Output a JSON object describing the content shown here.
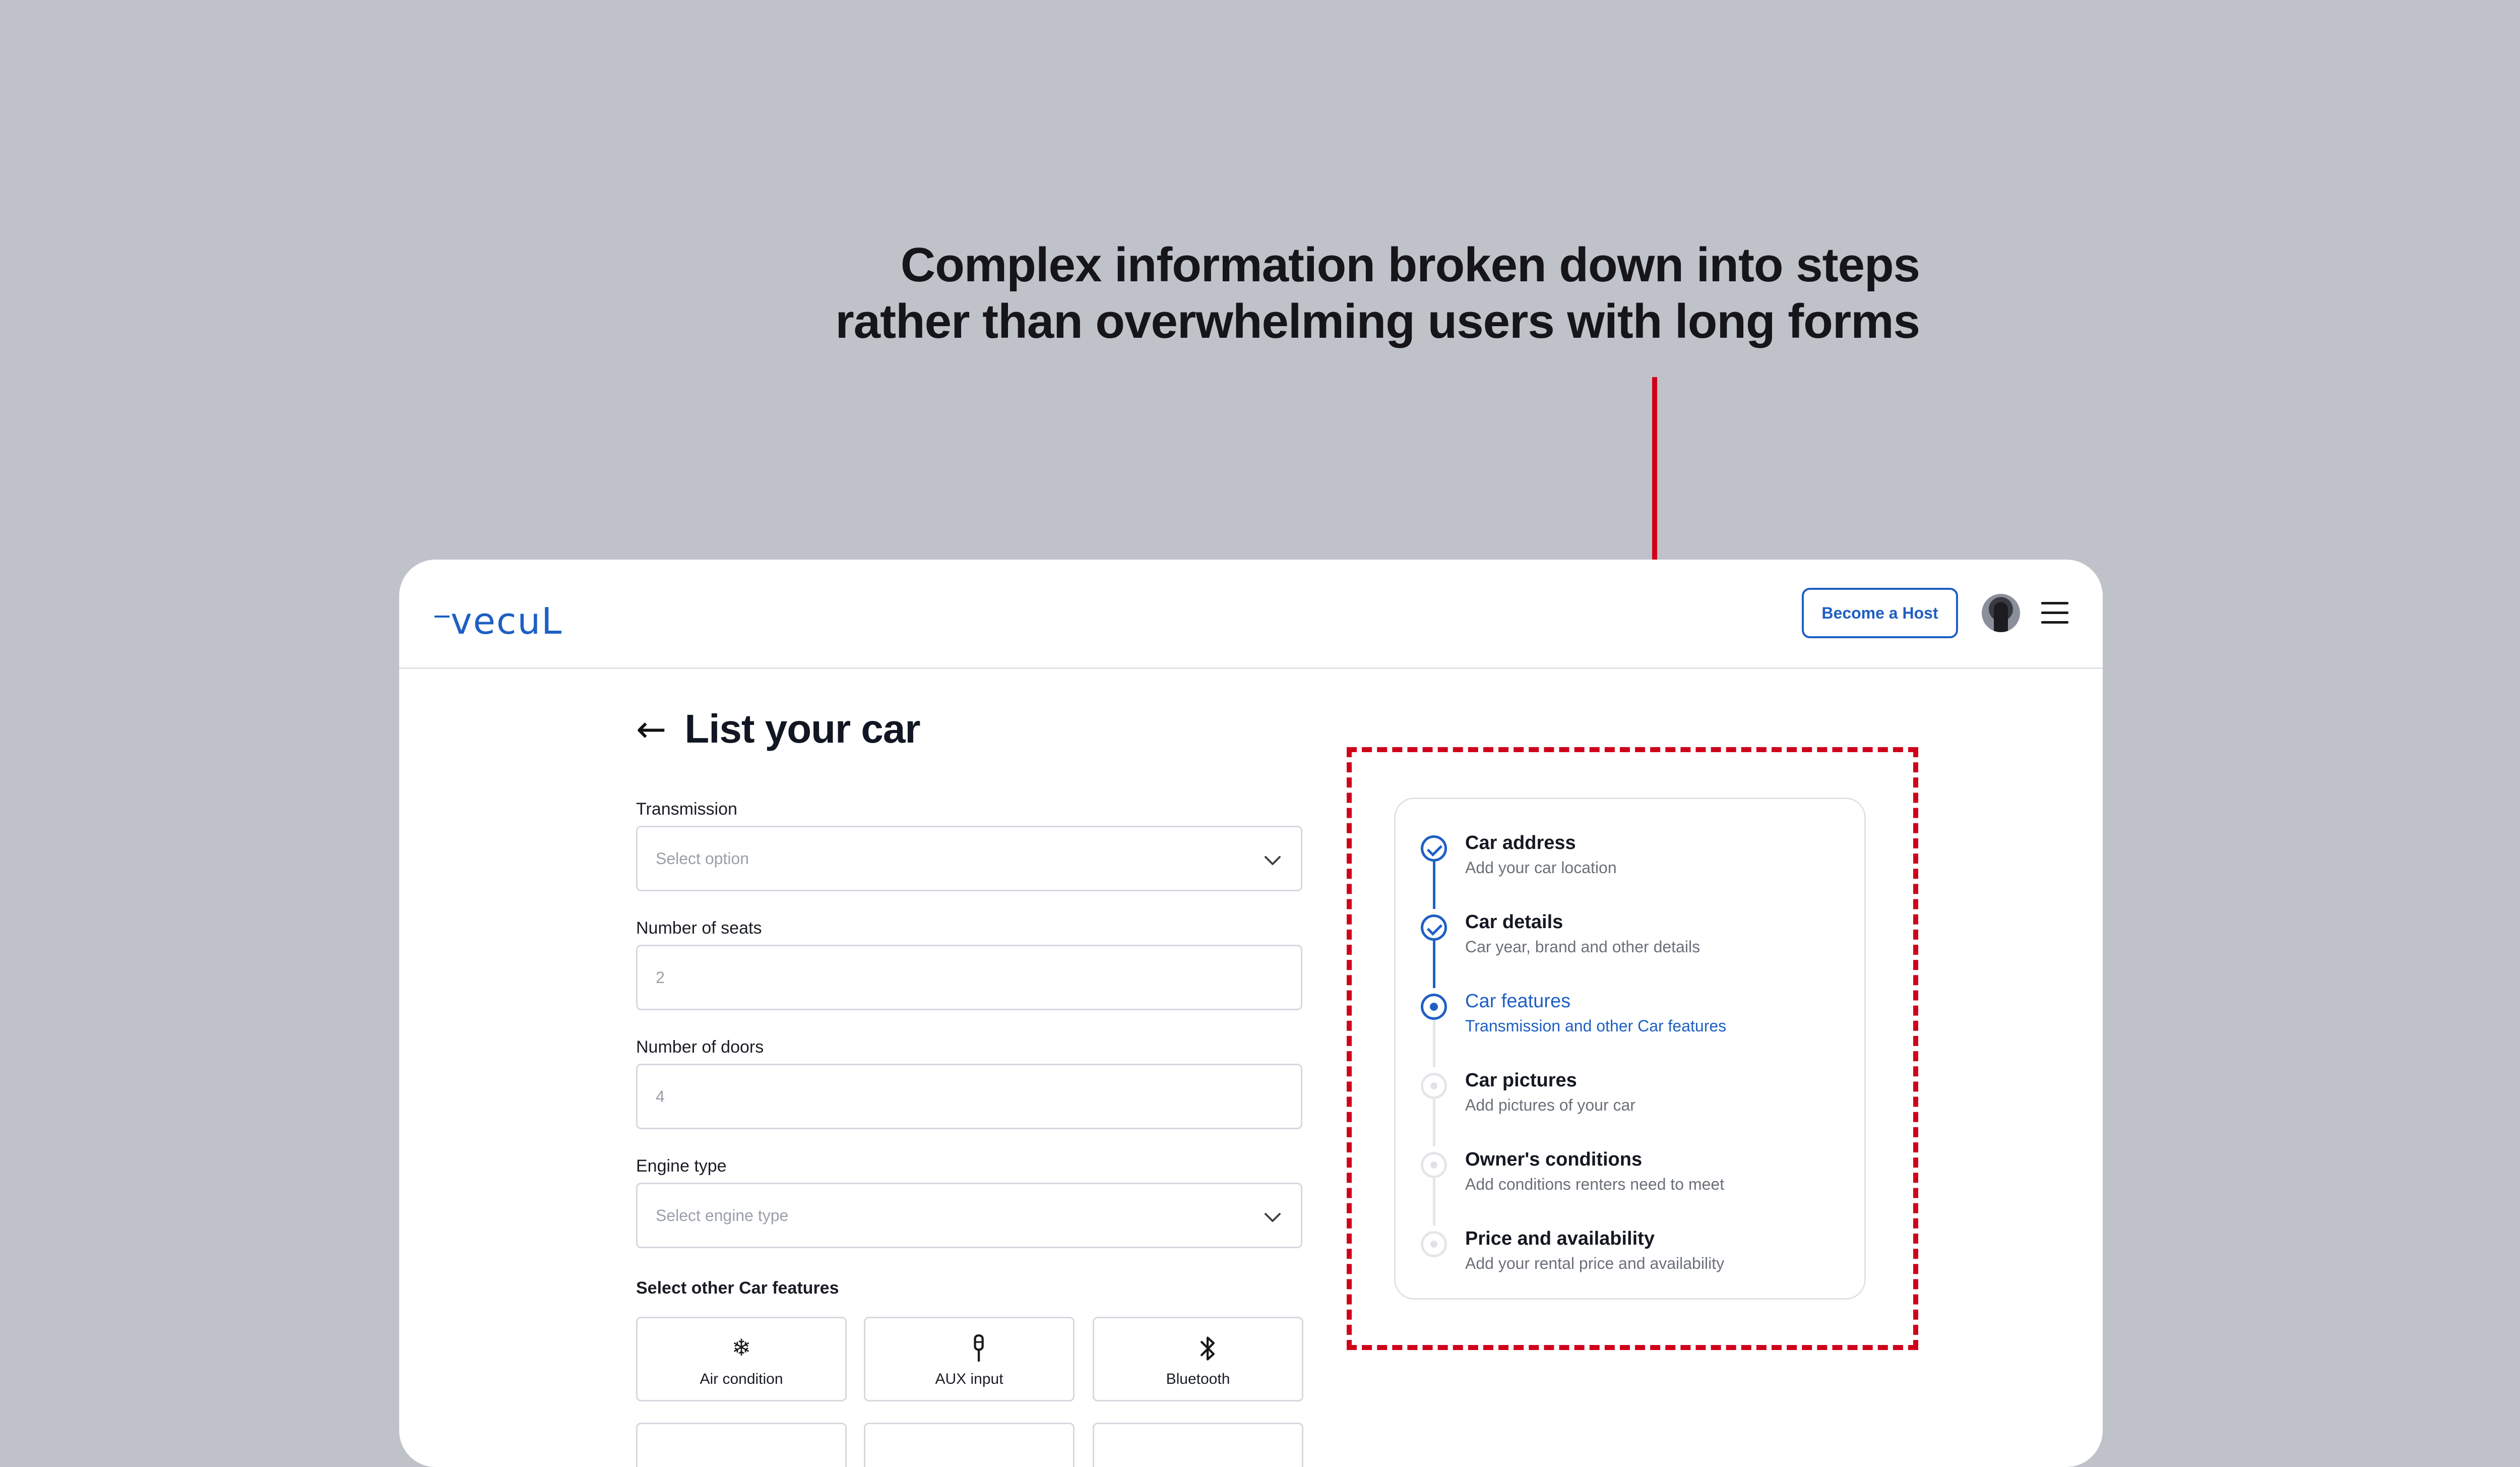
{
  "annotation": {
    "line1": "Complex information broken down into steps",
    "line2": "rather than overwhelming users with long forms",
    "arrow_color": "#d0021b",
    "highlight_color": "#d0021b"
  },
  "header": {
    "logo": "vecuL",
    "become_host_label": "Become a Host",
    "avatar_icon": "user-avatar",
    "menu_icon": "hamburger-menu-icon"
  },
  "page": {
    "back_icon": "←",
    "title": "List your car"
  },
  "form": {
    "transmission": {
      "label": "Transmission",
      "placeholder": "Select option"
    },
    "seats": {
      "label": "Number of seats",
      "placeholder": "2"
    },
    "doors": {
      "label": "Number of doors",
      "placeholder": "4"
    },
    "engine": {
      "label": "Engine type",
      "placeholder": "Select engine type"
    },
    "features_label": "Select other Car features",
    "features": [
      {
        "icon": "❄",
        "icon_name": "snowflake-icon",
        "label": "Air condition"
      },
      {
        "icon": "🎤",
        "icon_name": "aux-plug-icon",
        "label": "AUX input"
      },
      {
        "icon": "ᛒ",
        "icon_name": "bluetooth-icon",
        "label": "Bluetooth"
      }
    ]
  },
  "steps": [
    {
      "name": "Car address",
      "sub": "Add your car location",
      "state": "done"
    },
    {
      "name": "Car details",
      "sub": "Car year, brand and other details",
      "state": "done"
    },
    {
      "name": "Car features",
      "sub": "Transmission and other Car features",
      "state": "active"
    },
    {
      "name": "Car pictures",
      "sub": "Add pictures of your car",
      "state": "todo"
    },
    {
      "name": "Owner's conditions",
      "sub": "Add conditions renters need to meet",
      "state": "todo"
    },
    {
      "name": "Price and availability",
      "sub": "Add your rental price and availability",
      "state": "todo"
    }
  ],
  "colors": {
    "brand": "#1e5fc4",
    "background": "#bfc2c9"
  }
}
